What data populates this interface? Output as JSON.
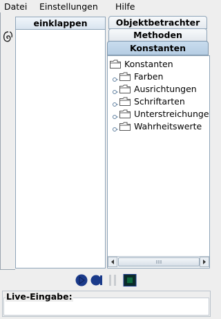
{
  "menubar": {
    "items": [
      "Datei",
      "Einstellungen",
      "Hilfe"
    ]
  },
  "left_panel": {
    "collapse_label": "einklappen"
  },
  "tabs": [
    {
      "label": "Objektbetrachter",
      "active": false
    },
    {
      "label": "Methoden",
      "active": false
    },
    {
      "label": "Konstanten",
      "active": true
    }
  ],
  "tree": {
    "root": {
      "label": "Konstanten",
      "icon": "folder-open-icon"
    },
    "children": [
      {
        "label": "Farben",
        "icon": "folder-icon"
      },
      {
        "label": "Ausrichtungen",
        "icon": "folder-icon"
      },
      {
        "label": "Schriftarten",
        "icon": "folder-icon"
      },
      {
        "label": "Unterstreichungen",
        "icon": "folder-icon"
      },
      {
        "label": "Wahrheitswerte",
        "icon": "folder-icon"
      }
    ]
  },
  "controls": {
    "icons": [
      "play-icon",
      "step-icon",
      "pause-icon",
      "stop-icon"
    ],
    "accent_color": "#1a3a8a",
    "stop_color": "#0e6b3e"
  },
  "live_input": {
    "label": "Live-Eingabe:",
    "value": ""
  }
}
